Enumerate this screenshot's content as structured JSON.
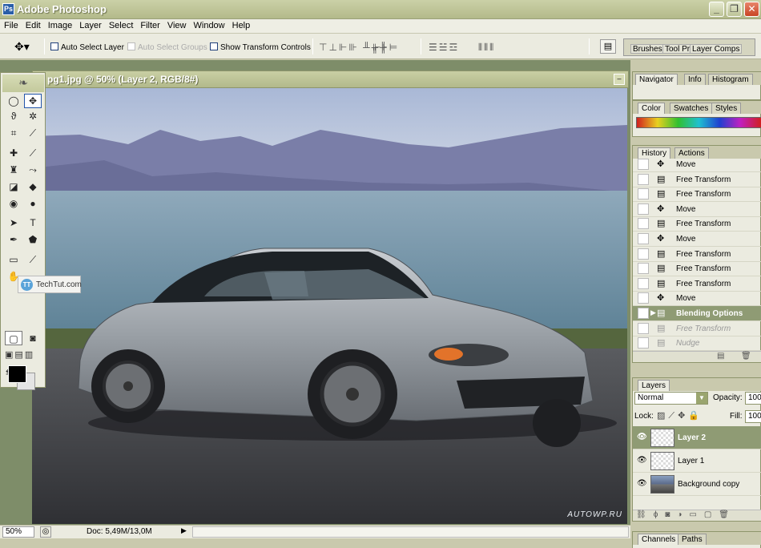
{
  "window": {
    "title": "Adobe Photoshop",
    "app_icon": "Ps",
    "minimize": "_",
    "maximize": "❐",
    "close": "✕"
  },
  "menu": [
    "File",
    "Edit",
    "Image",
    "Layer",
    "Select",
    "Filter",
    "View",
    "Window",
    "Help"
  ],
  "options": {
    "tool_icon": "move-tool-icon",
    "auto_select_layer": "Auto Select Layer",
    "auto_select_groups": "Auto Select Groups",
    "show_transform_controls": "Show Transform Controls"
  },
  "palette_well": {
    "tabs": [
      "Brushes",
      "Tool Pr",
      "Layer Comps"
    ]
  },
  "document": {
    "title": "pg1.jpg @ 50% (Layer 2, RGB/8#)",
    "watermark": "AUTOWP.RU"
  },
  "status": {
    "zoom": "50%",
    "doc": "Doc: 5,49M/13,0M"
  },
  "techtut": {
    "label": "TechTut.com",
    "icon": "TT"
  },
  "navigator": {
    "tabs": [
      "Navigator",
      "Info",
      "Histogram"
    ]
  },
  "color_palette": {
    "tabs": [
      "Color",
      "Swatches",
      "Styles"
    ]
  },
  "history": {
    "tabs": [
      "History",
      "Actions"
    ],
    "items": [
      {
        "icon": "move",
        "label": "Move",
        "state": "normal"
      },
      {
        "icon": "doc",
        "label": "Free Transform",
        "state": "normal"
      },
      {
        "icon": "doc",
        "label": "Free Transform",
        "state": "normal"
      },
      {
        "icon": "move",
        "label": "Move",
        "state": "normal"
      },
      {
        "icon": "doc",
        "label": "Free Transform",
        "state": "normal"
      },
      {
        "icon": "move",
        "label": "Move",
        "state": "normal"
      },
      {
        "icon": "doc",
        "label": "Free Transform",
        "state": "normal"
      },
      {
        "icon": "doc",
        "label": "Free Transform",
        "state": "normal"
      },
      {
        "icon": "doc",
        "label": "Free Transform",
        "state": "normal"
      },
      {
        "icon": "move",
        "label": "Move",
        "state": "normal"
      },
      {
        "icon": "doc",
        "label": "Blending Options",
        "state": "active"
      },
      {
        "icon": "doc",
        "label": "Free Transform",
        "state": "undone"
      },
      {
        "icon": "doc",
        "label": "Nudge",
        "state": "undone"
      }
    ]
  },
  "layers": {
    "title": "Layers",
    "blend_mode": "Normal",
    "opacity_label": "Opacity:",
    "opacity_value": "100",
    "lock_label": "Lock:",
    "fill_label": "Fill:",
    "fill_value": "100",
    "items": [
      {
        "name": "Layer 2",
        "thumb": "transparent",
        "active": true
      },
      {
        "name": "Layer 1",
        "thumb": "transparent",
        "active": false
      },
      {
        "name": "Background copy",
        "thumb": "image",
        "active": false
      }
    ]
  },
  "channels": {
    "tabs": [
      "Channels",
      "Paths"
    ]
  },
  "colors": {
    "titlebar": "#b3ba8a",
    "accent": "#8f9b74",
    "fg": "#000000",
    "bg": "#e4e4e4"
  }
}
